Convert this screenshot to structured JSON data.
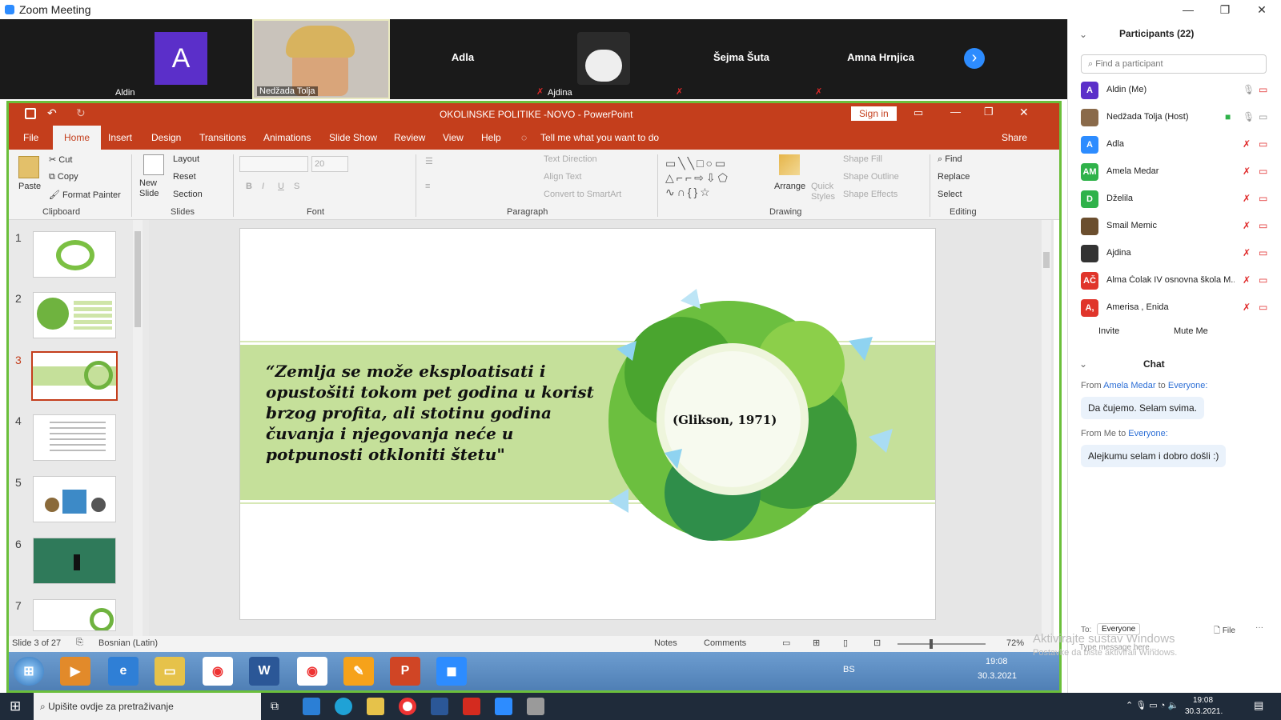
{
  "zoom": {
    "title": "Zoom Meeting",
    "controls": {
      "minimize": "—",
      "restore": "❐",
      "close": "✕"
    }
  },
  "gallery": {
    "tiles": [
      {
        "name": "Aldin",
        "avatar_letter": "A",
        "avatar_color": "#5b2fc9"
      },
      {
        "name": "Nedžada Tolja"
      },
      {
        "name": "Adla"
      },
      {
        "name": "Ajdina"
      },
      {
        "name": "Šejma Šuta"
      },
      {
        "name": "Amna Hrnjica"
      }
    ],
    "next_arrow": "›"
  },
  "ppt": {
    "doc_title": "OKOLINSKE POLITIKE -NOVO  -  PowerPoint",
    "sign_in": "Sign in",
    "tabs": [
      "File",
      "Home",
      "Insert",
      "Design",
      "Transitions",
      "Animations",
      "Slide Show",
      "Review",
      "View",
      "Help"
    ],
    "tell_me": "Tell me what you want to do",
    "share": "Share",
    "ribbon": {
      "clipboard": {
        "paste": "Paste",
        "cut": "Cut",
        "copy": "Copy",
        "format_painter": "Format Painter",
        "group": "Clipboard"
      },
      "slides": {
        "new_slide": "New Slide",
        "layout": "Layout",
        "reset": "Reset",
        "section": "Section",
        "group": "Slides"
      },
      "font": {
        "size": "20",
        "group": "Font"
      },
      "paragraph": {
        "text_direction": "Text Direction",
        "align_text": "Align Text",
        "smartart": "Convert to SmartArt",
        "group": "Paragraph"
      },
      "drawing": {
        "arrange": "Arrange",
        "quick_styles": "Quick Styles",
        "shape_fill": "Shape Fill",
        "shape_outline": "Shape Outline",
        "shape_effects": "Shape Effects",
        "group": "Drawing"
      },
      "editing": {
        "find": "Find",
        "replace": "Replace",
        "select": "Select",
        "group": "Editing"
      }
    },
    "slide_numbers": [
      "1",
      "2",
      "3",
      "4",
      "5",
      "6",
      "7"
    ],
    "selected_slide": 3,
    "slide": {
      "quote": "“Zemlja se može eksploatisati i opustošiti tokom pet godina u korist brzog profita, ali stotinu godina čuvanja i njegovanja neće u potpunosti otkloniti štetu\"",
      "citation": "(Glikson, 1971)"
    },
    "status": {
      "slide_info": "Slide 3 of 27",
      "language": "Bosnian (Latin)",
      "notes": "Notes",
      "comments": "Comments",
      "zoom": "72%"
    },
    "win7_tray": {
      "lang": "BS",
      "time": "19:08",
      "date": "30.3.2021"
    }
  },
  "participants": {
    "title": "Participants (22)",
    "search_placeholder": "Find a participant",
    "list": [
      {
        "name": "Aldin (Me)",
        "initials": "A",
        "color": "#5b2fc9"
      },
      {
        "name": "Nedžada Tolja (Host)",
        "initials": "",
        "color": "#8a6a4a"
      },
      {
        "name": "Adla",
        "initials": "A",
        "color": "#2d8cff"
      },
      {
        "name": "Amela Medar",
        "initials": "AM",
        "color": "#2fb24a"
      },
      {
        "name": "Dželila",
        "initials": "D",
        "color": "#2fb24a"
      },
      {
        "name": "Smail Memic",
        "initials": "",
        "color": "#6b4e2e"
      },
      {
        "name": "Ajdina",
        "initials": "",
        "color": "#333333"
      },
      {
        "name": "Alma Čolak IV osnovna škola M...",
        "initials": "AČ",
        "color": "#e0352b"
      },
      {
        "name": "Amerisa , Enida",
        "initials": "A,",
        "color": "#e0352b"
      }
    ],
    "invite": "Invite",
    "mute_me": "Mute Me"
  },
  "chat": {
    "title": "Chat",
    "messages": [
      {
        "from_label": "From",
        "from": "Amela Medar",
        "to_label": "to",
        "to": "Everyone:",
        "text": "Da čujemo. Selam svima."
      },
      {
        "from_label": "From Me to",
        "to": "Everyone:",
        "text": "Alejkumu selam i dobro došli :)"
      }
    ],
    "to_label": "To:",
    "to_value": "Everyone",
    "file": "File",
    "more": "···",
    "input_placeholder": "Type message here...",
    "watermark_1": "Aktivirajte sustav Windows",
    "watermark_2": "Postavke da biste aktivirali Windows."
  },
  "taskbar": {
    "search_placeholder": "Upišite ovdje za pretraživanje",
    "time": "19:08",
    "date": "30.3.2021."
  }
}
